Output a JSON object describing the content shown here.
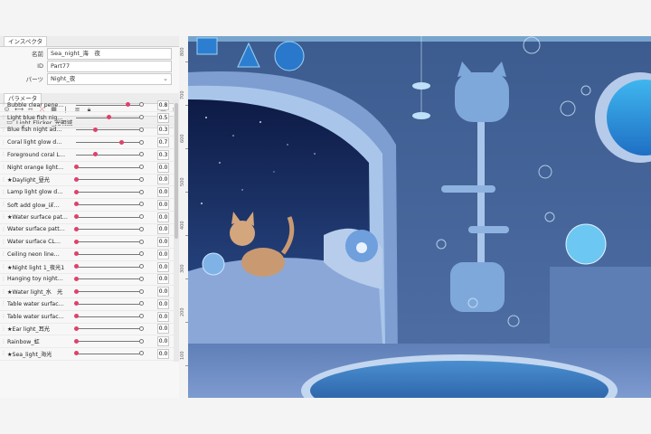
{
  "inspector": {
    "tab": "インスペクタ",
    "name_label": "名前",
    "name_value": "Sea_night_海　夜",
    "id_label": "ID",
    "id_value": "Part77",
    "parts_label": "パーツ",
    "parts_value": "Night_夜"
  },
  "parameters": {
    "tab": "パラメータ",
    "group_label": "Light Flicker_光明滅",
    "items": [
      {
        "name": "Bubble clear pene…",
        "value": "0.8",
        "pos": 0.8
      },
      {
        "name": "Light blue fish nig…",
        "value": "0.5",
        "pos": 0.5
      },
      {
        "name": "Blue fish  night ad…",
        "value": "0.3",
        "pos": 0.3
      },
      {
        "name": "Coral light glow d…",
        "value": "0.7",
        "pos": 0.7
      },
      {
        "name": "Foreground coral L…",
        "value": "0.3",
        "pos": 0.3
      },
      {
        "name": "Night orange light…",
        "value": "0.0",
        "pos": 0
      },
      {
        "name": "★Daylight_昼光",
        "value": "0.0",
        "pos": 0
      },
      {
        "name": "Lamp light glow d…",
        "value": "0.0",
        "pos": 0
      },
      {
        "name": "Soft add glow_ぼ…",
        "value": "0.0",
        "pos": 0
      },
      {
        "name": "★Water surface pat…",
        "value": "0.0",
        "pos": 0
      },
      {
        "name": "Water surface patt…",
        "value": "0.0",
        "pos": 0
      },
      {
        "name": "Water surface CL…",
        "value": "0.0",
        "pos": 0
      },
      {
        "name": "Ceiling neon line…",
        "value": "0.0",
        "pos": 0
      },
      {
        "name": "★Night light 1_夜光1",
        "value": "0.0",
        "pos": 0
      },
      {
        "name": "Hanging toy night…",
        "value": "0.0",
        "pos": 0
      },
      {
        "name": "★Water light_水　光",
        "value": "0.0",
        "pos": 0
      },
      {
        "name": "Table water surfac…",
        "value": "0.0",
        "pos": 0
      },
      {
        "name": "Table water surfac…",
        "value": "0.0",
        "pos": 0
      },
      {
        "name": "★Ear light_耳光",
        "value": "0.0",
        "pos": 0
      },
      {
        "name": "Rainbow_虹",
        "value": "0.0",
        "pos": 0
      },
      {
        "name": "★Sea_light_海光",
        "value": "0.0",
        "pos": 0
      }
    ]
  },
  "ruler_ticks": [
    "800",
    "700",
    "600",
    "500",
    "400",
    "300",
    "200",
    "100"
  ],
  "canvas": {
    "description": "blue underwater-night room illustration with cat in bed nook",
    "accent": "#5aa8e0"
  }
}
